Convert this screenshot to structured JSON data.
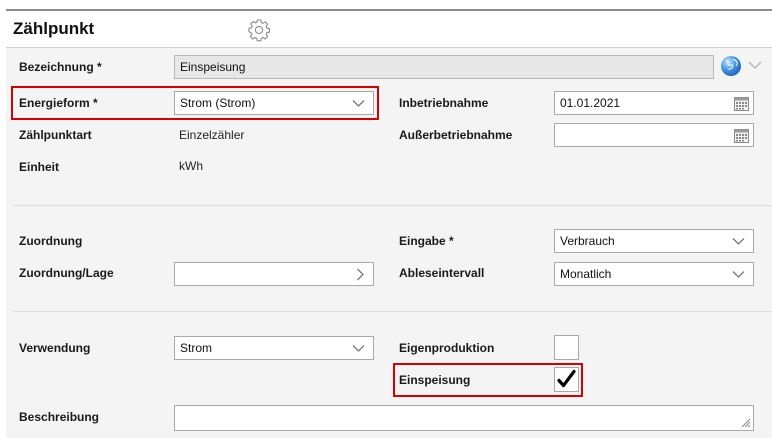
{
  "header": {
    "title": "Zählpunkt",
    "settings_icon": "gear-icon"
  },
  "colors": {
    "highlight": "#d40000",
    "form_background": "#f4f4f4",
    "readonly_field": "#e7e7e7"
  },
  "fields": {
    "bezeichnung": {
      "label": "Bezeichnung *",
      "value": "Einspeisung"
    },
    "energieform": {
      "label": "Energieform *",
      "value": "Strom (Strom)"
    },
    "zaehlpunktart": {
      "label": "Zählpunktart",
      "value": "Einzelzähler"
    },
    "einheit": {
      "label": "Einheit",
      "value": "kWh"
    },
    "inbetriebnahme": {
      "label": "Inbetriebnahme",
      "value": "01.01.2021"
    },
    "ausserbetriebnahme": {
      "label": "Außerbetriebnahme",
      "value": ""
    },
    "zuordnung": {
      "label": "Zuordnung"
    },
    "zuordnung_lage": {
      "label": "Zuordnung/Lage",
      "value": ""
    },
    "eingabe": {
      "label": "Eingabe *",
      "value": "Verbrauch"
    },
    "ableseintervall": {
      "label": "Ableseintervall",
      "value": "Monatlich"
    },
    "verwendung": {
      "label": "Verwendung",
      "value": "Strom"
    },
    "eigenproduktion": {
      "label": "Eigenproduktion",
      "checked": false
    },
    "einspeisung": {
      "label": "Einspeisung",
      "checked": true
    },
    "beschreibung": {
      "label": "Beschreibung",
      "value": ""
    }
  }
}
